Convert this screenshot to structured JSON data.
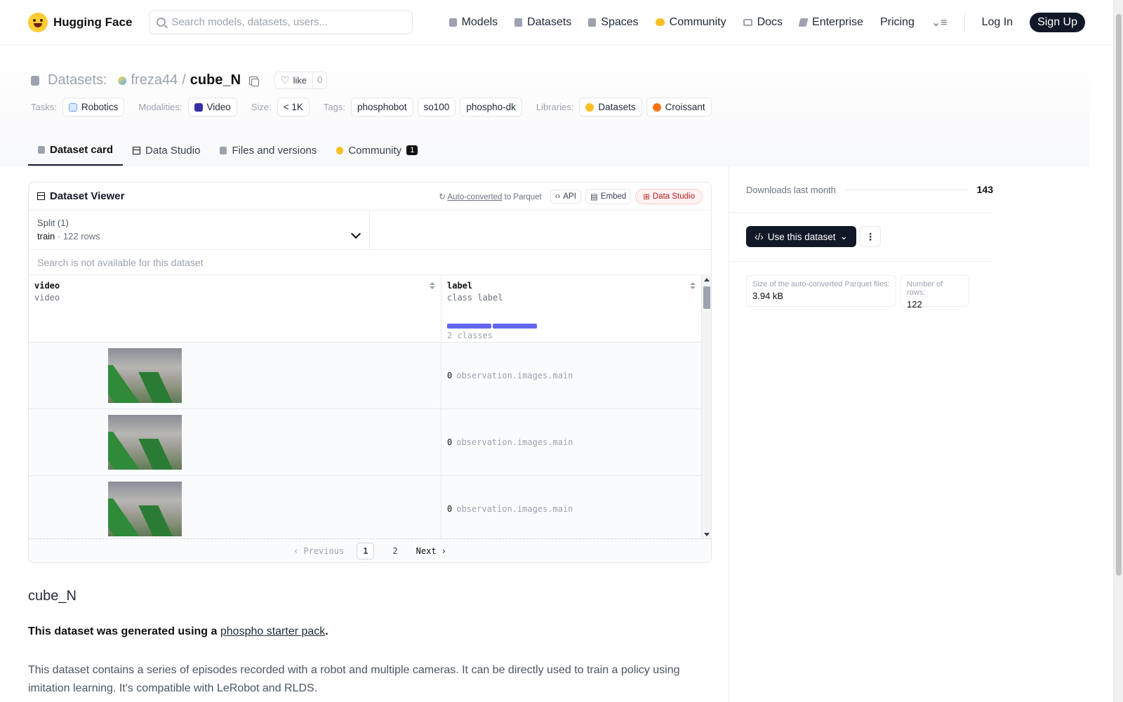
{
  "nav": {
    "brand": "Hugging Face",
    "search_placeholder": "Search models, datasets, users...",
    "items": [
      "Models",
      "Datasets",
      "Spaces",
      "Community",
      "Docs",
      "Enterprise",
      "Pricing"
    ],
    "login": "Log In",
    "signup": "Sign Up"
  },
  "header": {
    "section": "Datasets:",
    "owner": "freza44",
    "separator": "/",
    "name": "cube_N",
    "like_label": "like",
    "like_count": "0",
    "tasks_label": "Tasks:",
    "task": "Robotics",
    "modalities_label": "Modalities:",
    "modality": "Video",
    "size_label": "Size:",
    "size": "< 1K",
    "tags_label": "Tags:",
    "tags": [
      "phosphobot",
      "so100",
      "phospho-dk"
    ],
    "libraries_label": "Libraries:",
    "libraries": [
      "Datasets",
      "Croissant"
    ]
  },
  "tabs": {
    "dataset_card": "Dataset card",
    "data_studio": "Data Studio",
    "files": "Files and versions",
    "community": "Community",
    "community_badge": "1"
  },
  "viewer": {
    "title": "Dataset Viewer",
    "auto_converted": "Auto-converted",
    "to_parquet": "to Parquet",
    "api": "API",
    "embed": "Embed",
    "data_studio": "Data Studio",
    "split_label": "Split (1)",
    "split_name": "train",
    "split_dot": "·",
    "split_rows": "122 rows",
    "search_na": "Search is not available for this dataset",
    "columns": [
      {
        "name": "video",
        "type": "video"
      },
      {
        "name": "label",
        "type": "class label"
      }
    ],
    "classes": "2 classes",
    "rows": [
      {
        "value": "0",
        "text": "observation.images.main"
      },
      {
        "value": "0",
        "text": "observation.images.main"
      },
      {
        "value": "0",
        "text": "observation.images.main"
      }
    ],
    "pager": {
      "prev": "Previous",
      "pages": [
        "1",
        "2"
      ],
      "current": "1",
      "next": "Next"
    }
  },
  "card": {
    "heading": "cube_N",
    "generated_prefix": "This dataset was generated using a",
    "link_text": "phospho starter pack",
    "generated_suffix": ".",
    "description": "This dataset contains a series of episodes recorded with a robot and multiple cameras. It can be directly used to train a policy using imitation learning. It's compatible with LeRobot and RLDS."
  },
  "sidebar": {
    "downloads_label": "Downloads last month",
    "downloads_value": "143",
    "use_button": "Use this dataset",
    "parquet_size_label": "Size of the auto-converted Parquet files:",
    "parquet_size_value": "3.94 kB",
    "rows_label": "Number of rows:",
    "rows_value": "122"
  }
}
